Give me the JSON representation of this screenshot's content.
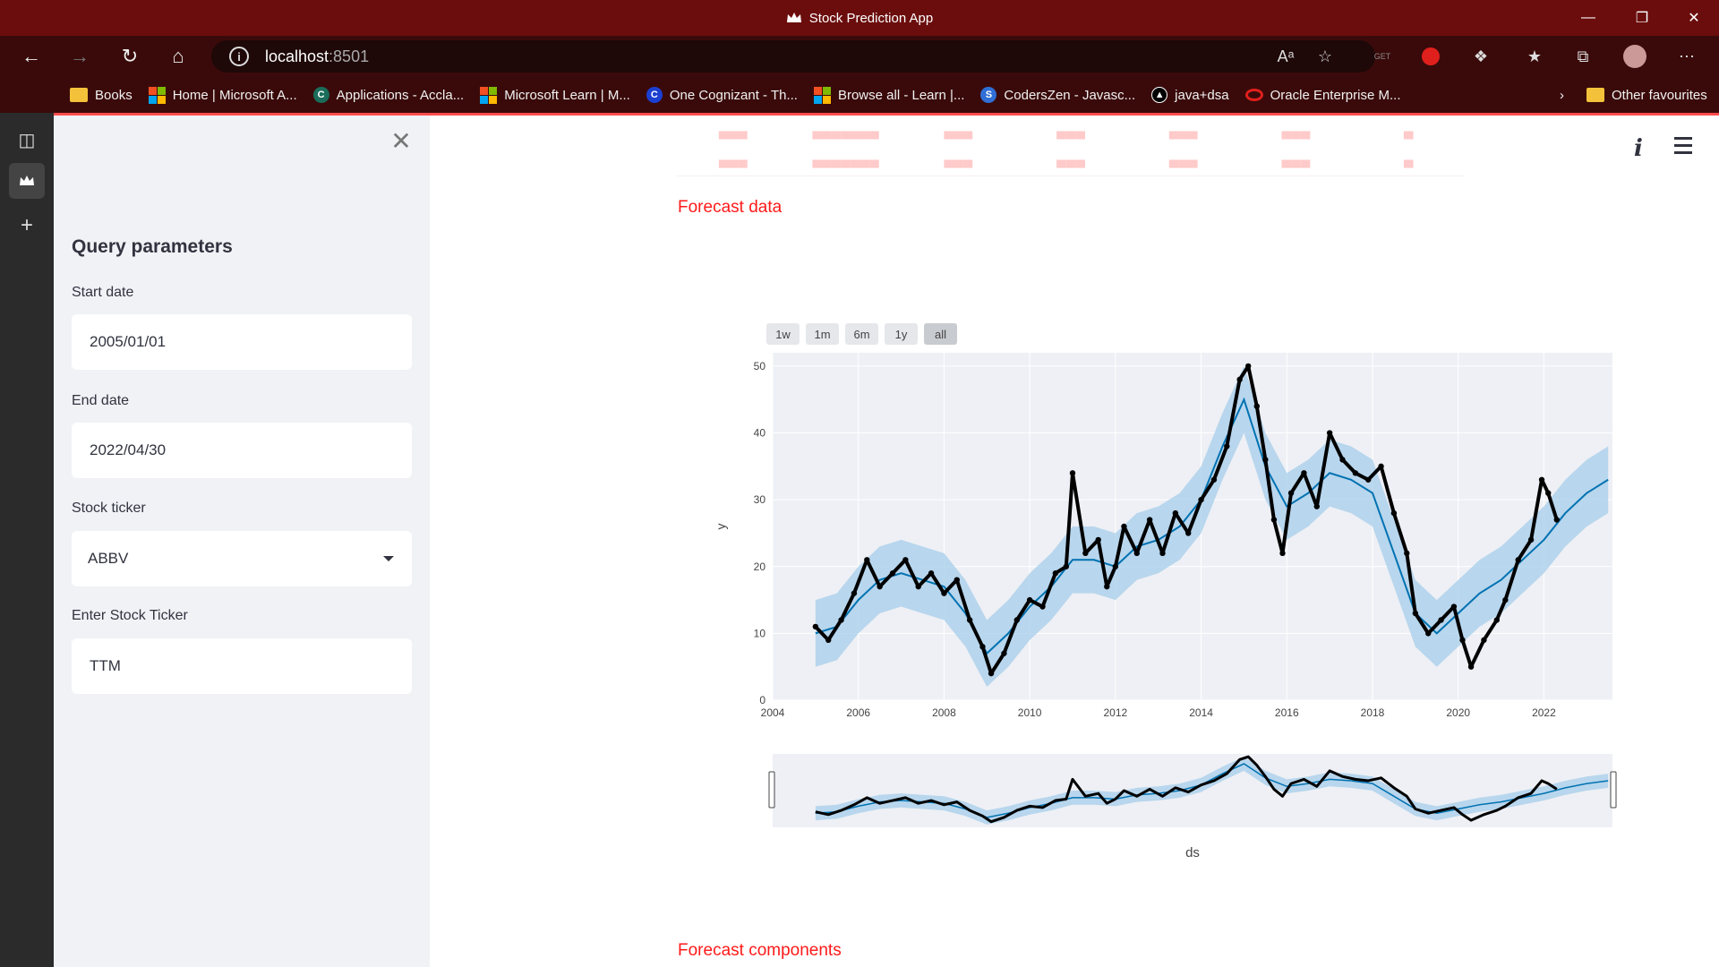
{
  "window": {
    "title": "Stock Prediction App"
  },
  "address": {
    "host": "localhost",
    "port": ":8501"
  },
  "favorites": [
    {
      "label": "Books",
      "icon": "folder-icon"
    },
    {
      "label": "Home | Microsoft A...",
      "icon": "microsoft-icon"
    },
    {
      "label": "Applications - Accla...",
      "icon": "acclaim-icon"
    },
    {
      "label": "Microsoft Learn | M...",
      "icon": "microsoft-icon"
    },
    {
      "label": "One Cognizant - Th...",
      "icon": "cognizant-icon"
    },
    {
      "label": "Browse all - Learn |...",
      "icon": "microsoft-icon"
    },
    {
      "label": "CodersZen - Javasc...",
      "icon": "coderszen-icon"
    },
    {
      "label": "java+dsa",
      "icon": "triangle-icon"
    },
    {
      "label": "Oracle Enterprise M...",
      "icon": "oracle-icon"
    }
  ],
  "favorites_other": "Other favourites",
  "sidebar": {
    "heading": "Query parameters",
    "start_label": "Start date",
    "start_value": "2005/01/01",
    "end_label": "End date",
    "end_value": "2022/04/30",
    "ticker_label": "Stock ticker",
    "ticker_value": "ABBV",
    "enter_label": "Enter Stock Ticker",
    "enter_value": "TTM"
  },
  "main": {
    "forecast_data_title": "Forecast data",
    "forecast_components_title": "Forecast components",
    "range_buttons": [
      "1w",
      "1m",
      "6m",
      "1y",
      "all"
    ],
    "active_range": "all"
  },
  "colors": {
    "accent": "#ff4b4b",
    "titlebar": "#6b0d0d",
    "forecast_line": "#0072b2",
    "band": "#a6cdea",
    "points": "#000000"
  },
  "chart_data": {
    "type": "line",
    "xlabel": "ds",
    "ylabel": "y",
    "xlim": [
      2004,
      2023.6
    ],
    "ylim": [
      0,
      52
    ],
    "xticks": [
      2004,
      2006,
      2008,
      2010,
      2012,
      2014,
      2016,
      2018,
      2020,
      2022
    ],
    "yticks": [
      0,
      10,
      20,
      30,
      40,
      50
    ],
    "grid": true,
    "rangeslider": true,
    "series": [
      {
        "kind": "observed",
        "x": [
          2005.0,
          2005.3,
          2005.6,
          2005.9,
          2006.2,
          2006.5,
          2006.8,
          2007.1,
          2007.4,
          2007.7,
          2008.0,
          2008.3,
          2008.6,
          2008.9,
          2009.1,
          2009.4,
          2009.7,
          2010.0,
          2010.3,
          2010.6,
          2010.85,
          2011.0,
          2011.3,
          2011.6,
          2011.8,
          2012.0,
          2012.2,
          2012.5,
          2012.8,
          2013.1,
          2013.4,
          2013.7,
          2014.0,
          2014.3,
          2014.6,
          2014.9,
          2015.1,
          2015.3,
          2015.5,
          2015.7,
          2015.9,
          2016.1,
          2016.4,
          2016.7,
          2017.0,
          2017.3,
          2017.6,
          2017.9,
          2018.2,
          2018.5,
          2018.8,
          2019.0,
          2019.3,
          2019.6,
          2019.9,
          2020.1,
          2020.3,
          2020.6,
          2020.9,
          2021.1,
          2021.4,
          2021.7,
          2021.95,
          2022.1,
          2022.3
        ],
        "y": [
          11,
          9,
          12,
          16,
          21,
          17,
          19,
          21,
          17,
          19,
          16,
          18,
          12,
          8,
          4,
          7,
          12,
          15,
          14,
          19,
          20,
          34,
          22,
          24,
          17,
          20,
          26,
          22,
          27,
          22,
          28,
          25,
          30,
          33,
          38,
          48,
          50,
          44,
          36,
          27,
          22,
          31,
          34,
          29,
          40,
          36,
          34,
          33,
          35,
          28,
          22,
          13,
          10,
          12,
          14,
          9,
          5,
          9,
          12,
          15,
          21,
          24,
          33,
          31,
          27
        ]
      },
      {
        "kind": "forecast",
        "x": [
          2005.0,
          2005.5,
          2006.0,
          2006.5,
          2007.0,
          2007.5,
          2008.0,
          2008.5,
          2009.0,
          2009.5,
          2010.0,
          2010.5,
          2011.0,
          2011.5,
          2012.0,
          2012.5,
          2013.0,
          2013.5,
          2014.0,
          2014.5,
          2015.0,
          2015.5,
          2016.0,
          2016.5,
          2017.0,
          2017.5,
          2018.0,
          2018.5,
          2019.0,
          2019.5,
          2020.0,
          2020.5,
          2021.0,
          2021.5,
          2022.0,
          2022.5,
          2023.0,
          2023.5
        ],
        "y": [
          10,
          11,
          15,
          18,
          19,
          18,
          17,
          13,
          7,
          10,
          14,
          17,
          21,
          21,
          20,
          23,
          24,
          26,
          30,
          38,
          45,
          35,
          29,
          31,
          34,
          33,
          31,
          22,
          13,
          10,
          13,
          16,
          18,
          21,
          24,
          28,
          31,
          33
        ],
        "band_width": 5
      }
    ]
  }
}
